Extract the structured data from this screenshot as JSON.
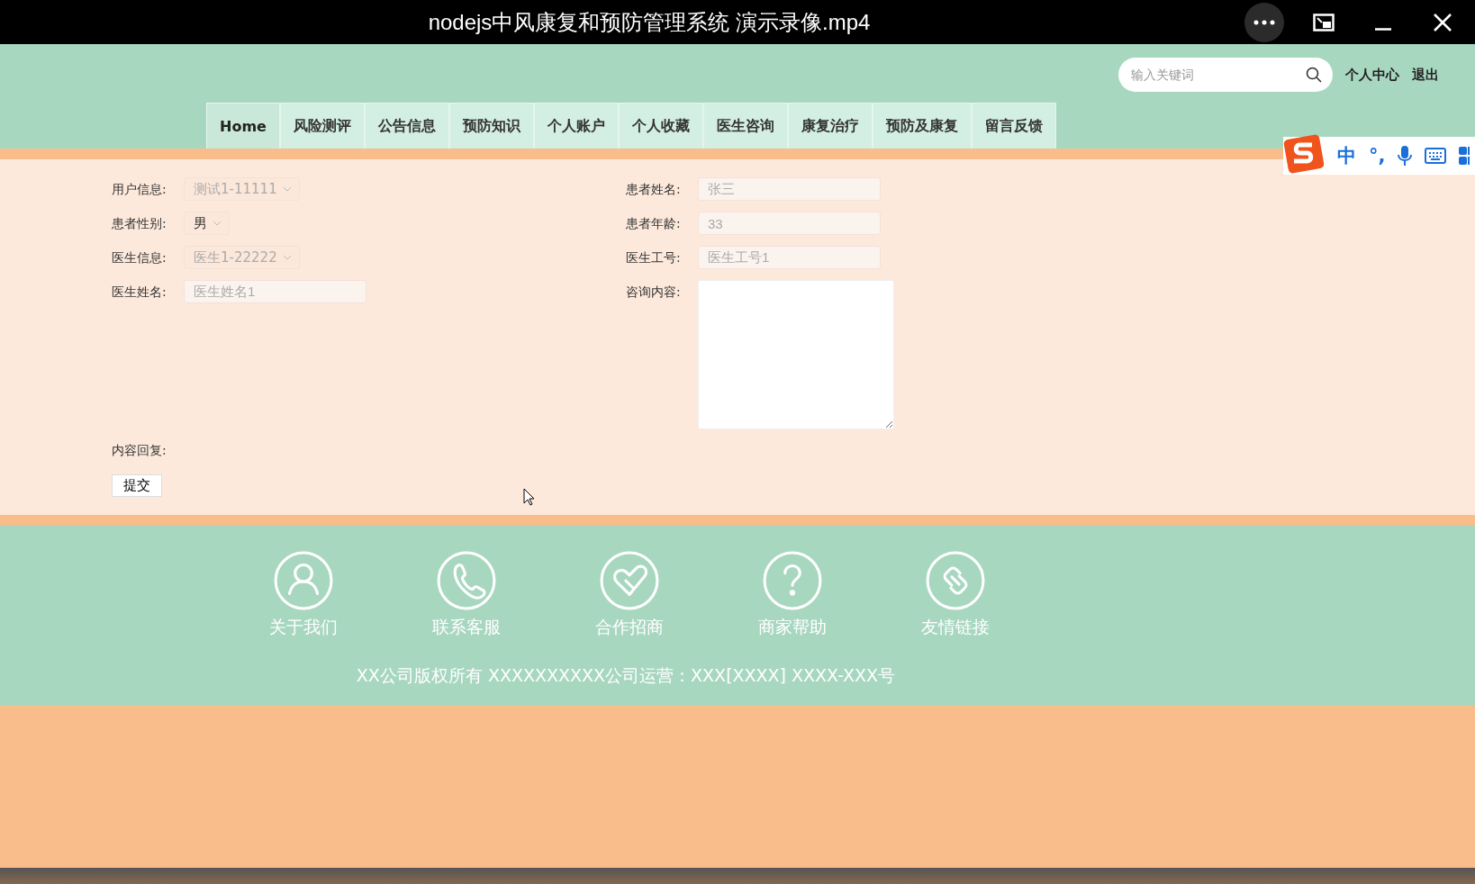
{
  "player": {
    "title": "nodejs中风康复和预防管理系统 演示录像.mp4"
  },
  "header": {
    "search": {
      "placeholder": "输入关键词"
    },
    "links": [
      "个人中心",
      "退出"
    ]
  },
  "nav": [
    {
      "label": "Home",
      "selected": true
    },
    {
      "label": "风险测评",
      "selected": false
    },
    {
      "label": "公告信息",
      "selected": false
    },
    {
      "label": "预防知识",
      "selected": false
    },
    {
      "label": "个人账户",
      "selected": false
    },
    {
      "label": "个人收藏",
      "selected": false
    },
    {
      "label": "医生咨询",
      "selected": false
    },
    {
      "label": "康复治疗",
      "selected": false
    },
    {
      "label": "预防及康复",
      "selected": false
    },
    {
      "label": "留言反馈",
      "selected": false
    }
  ],
  "ime": {
    "mode": "中",
    "punct": "°,"
  },
  "form": {
    "left": [
      {
        "label": "用户信息:",
        "kind": "select",
        "value": "测试1-11111",
        "disabled": true
      },
      {
        "label": "患者性别:",
        "kind": "select",
        "value": "男",
        "disabled": false
      },
      {
        "label": "医生信息:",
        "kind": "select",
        "value": "医生1-22222",
        "disabled": true
      },
      {
        "label": "医生姓名:",
        "kind": "input",
        "value": "医生姓名1",
        "disabled": true
      }
    ],
    "right": [
      {
        "label": "患者姓名:",
        "kind": "input",
        "value": "张三",
        "disabled": true
      },
      {
        "label": "患者年龄:",
        "kind": "input",
        "value": "33",
        "disabled": true
      },
      {
        "label": "医生工号:",
        "kind": "input",
        "value": "医生工号1",
        "disabled": true
      },
      {
        "label": "咨询内容:",
        "kind": "textarea"
      }
    ],
    "reply_label": "内容回复:",
    "submit": "提交"
  },
  "footer": {
    "links": [
      {
        "label": "关于我们",
        "kind": "person"
      },
      {
        "label": "联系客服",
        "kind": "phone"
      },
      {
        "label": "合作招商",
        "kind": "heart"
      },
      {
        "label": "商家帮助",
        "kind": "question"
      },
      {
        "label": "友情链接",
        "kind": "link"
      }
    ],
    "copyright": "XX公司版权所有 XXXXXXXXXX公司运营：XXX[XXXX] XXXX-XXX号"
  }
}
